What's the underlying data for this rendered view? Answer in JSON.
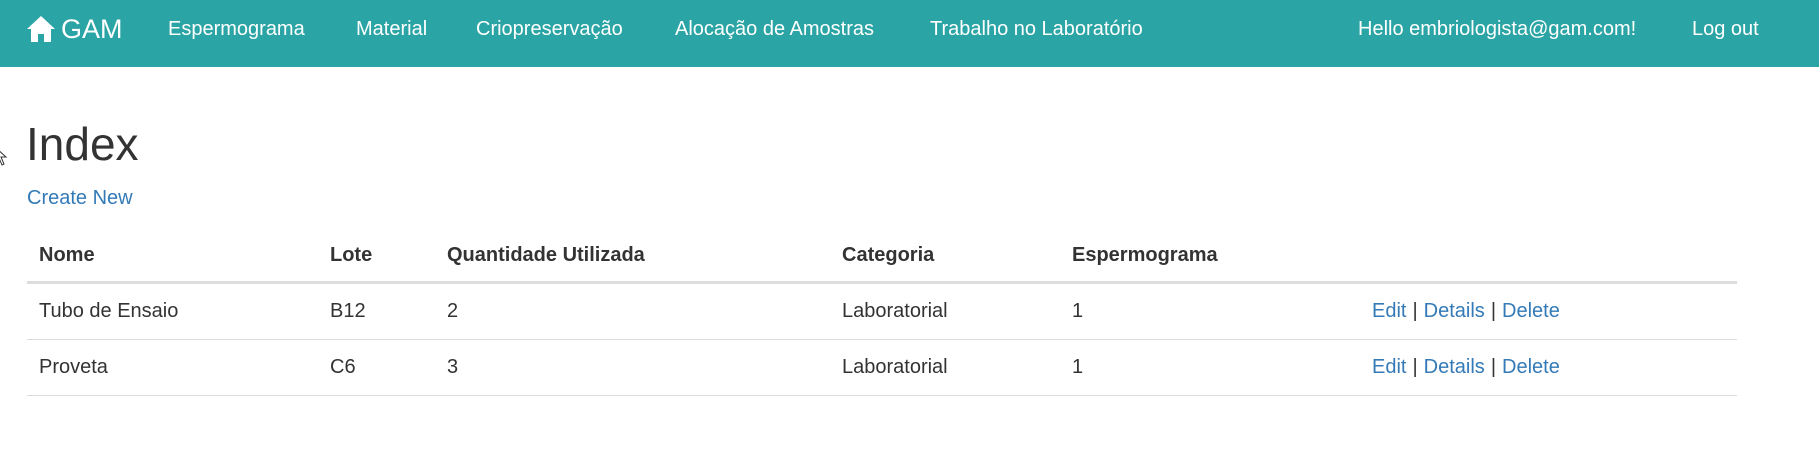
{
  "navbar": {
    "brand_label": "GAM",
    "brand_icon": "home-icon",
    "items": [
      {
        "label": "Espermograma"
      },
      {
        "label": "Material"
      },
      {
        "label": "Criopreservação"
      },
      {
        "label": "Alocação de Amostras"
      },
      {
        "label": "Trabalho no Laboratório"
      }
    ],
    "greeting": "Hello embriologista@gam.com!",
    "logout_label": "Log out",
    "background_color": "#2aa4a4"
  },
  "main": {
    "title": "Index",
    "create_link": "Create New",
    "link_color": "#337ab7",
    "table": {
      "headers": [
        "Nome",
        "Lote",
        "Quantidade Utilizada",
        "Categoria",
        "Espermograma"
      ],
      "rows": [
        {
          "nome": "Tubo de Ensaio",
          "lote": "B12",
          "quantidade": "2",
          "categoria": "Laboratorial",
          "espermograma": "1"
        },
        {
          "nome": "Proveta",
          "lote": "C6",
          "quantidade": "3",
          "categoria": "Laboratorial",
          "espermograma": "1"
        }
      ],
      "actions": {
        "edit": "Edit",
        "details": "Details",
        "delete": "Delete",
        "separator": "|"
      }
    }
  }
}
